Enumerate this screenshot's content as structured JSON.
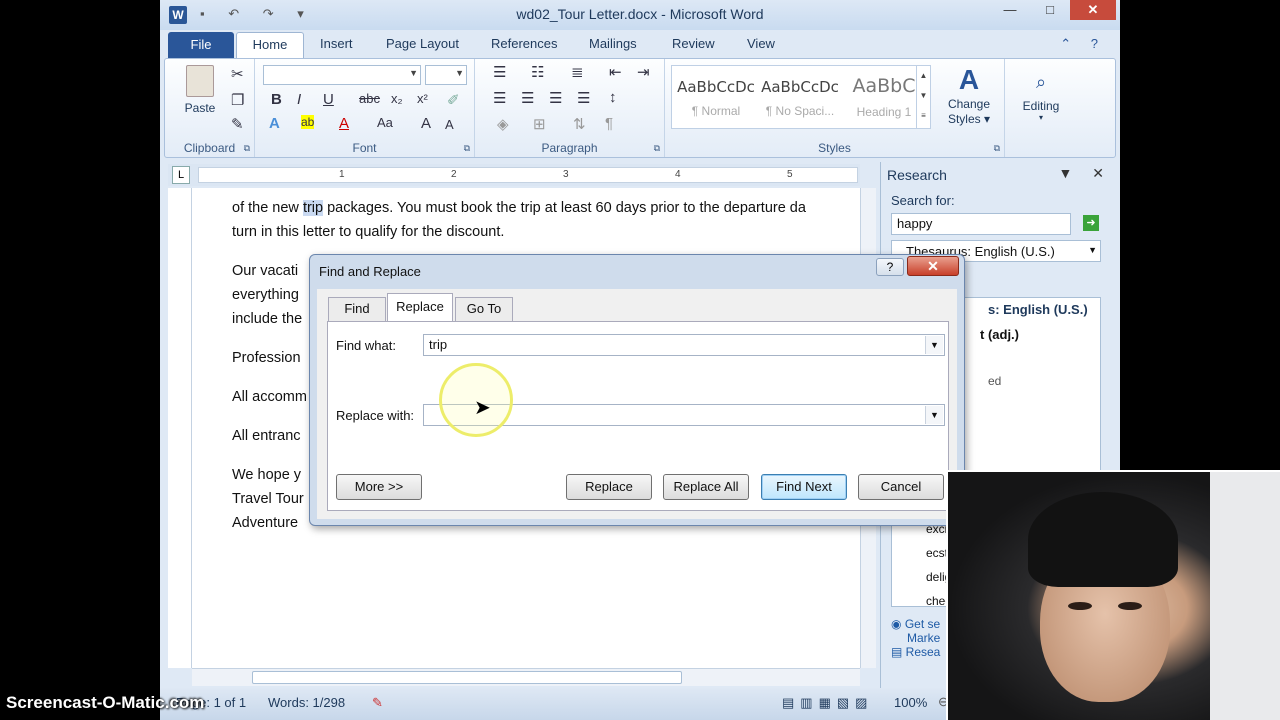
{
  "window": {
    "title": "wd02_Tour Letter.docx - Microsoft Word",
    "app_icon": "W"
  },
  "ribbon_tabs": [
    "File",
    "Home",
    "Insert",
    "Page Layout",
    "References",
    "Mailings",
    "Review",
    "View"
  ],
  "ribbon": {
    "clipboard": {
      "label": "Clipboard",
      "paste": "Paste"
    },
    "font": {
      "label": "Font"
    },
    "paragraph": {
      "label": "Paragraph"
    },
    "styles": {
      "label": "Styles",
      "items": [
        {
          "preview": "AaBbCcDc",
          "name": "¶ Normal"
        },
        {
          "preview": "AaBbCcDc",
          "name": "¶ No Spaci..."
        },
        {
          "preview": "AaBbC",
          "name": "Heading 1"
        }
      ],
      "change_styles": "Change Styles",
      "editing": "Editing"
    }
  },
  "ruler": {
    "numbers": [
      "1",
      "2",
      "3",
      "4",
      "5"
    ]
  },
  "document": {
    "line1_pre": "of the new ",
    "line1_hl": "trip",
    "line1_post": " packages. You must book the trip at least 60 days prior to the departure da",
    "line2": "turn in this letter to qualify for the discount.",
    "p2_l1": "Our vacati",
    "p2_l2": "everything",
    "p2_l3": "include the",
    "p3": "Profession",
    "p4": "All accomm",
    "p5": "All entranc",
    "p6_l1": "We hope y",
    "p6_l2": "Travel Tour",
    "p6_l3": "Adventure"
  },
  "status": {
    "page": "Page: 1 of 1",
    "words": "Words: 1/298",
    "zoom": "100%"
  },
  "research": {
    "title": "Research",
    "search_for_label": "Search for:",
    "search_value": "happy",
    "source": "Thesaurus: English (U.S.)",
    "results_title": "s: English (U.S.)",
    "results_pos": "t (adj.)",
    "results_word": "ed",
    "synonyms": [
      "exci",
      "ecsta",
      "delig",
      "chee"
    ],
    "footer1": "Get se",
    "footer2": "Marke",
    "footer3": "Resea"
  },
  "dialog": {
    "title": "Find and Replace",
    "tabs": [
      "Find",
      "Replace",
      "Go To"
    ],
    "find_label": "Find what:",
    "find_value": "trip",
    "replace_label": "Replace with:",
    "replace_value": "",
    "buttons": {
      "more": "More >>",
      "replace": "Replace",
      "replace_all": "Replace All",
      "find_next": "Find Next",
      "cancel": "Cancel"
    }
  },
  "watermark": "Screencast-O-Matic.com"
}
